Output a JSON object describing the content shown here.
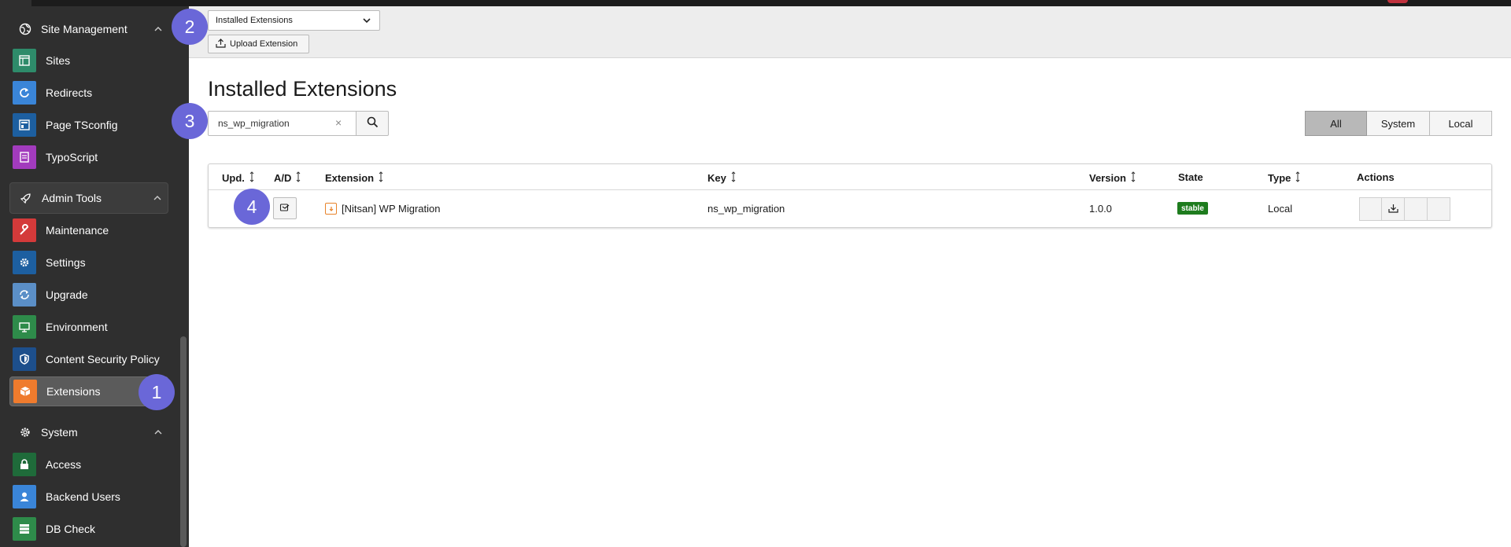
{
  "sidebar": {
    "groups": {
      "site_management": {
        "label": "Site Management",
        "icon": "globe-icon"
      },
      "admin_tools": {
        "label": "Admin Tools",
        "icon": "rocket-icon"
      },
      "system": {
        "label": "System",
        "icon": "gear-icon"
      }
    },
    "items": {
      "sites": {
        "label": "Sites",
        "color": "#2e8b6a"
      },
      "redirects": {
        "label": "Redirects",
        "color": "#3a85d8"
      },
      "page_tsconfig": {
        "label": "Page TSconfig",
        "color": "#1d5fa0"
      },
      "typoscript": {
        "label": "TypoScript",
        "color": "#a23bbd"
      },
      "maintenance": {
        "label": "Maintenance",
        "color": "#d43a3a"
      },
      "settings": {
        "label": "Settings",
        "color": "#1d5fa0"
      },
      "upgrade": {
        "label": "Upgrade",
        "color": "#5b8fc7"
      },
      "environment": {
        "label": "Environment",
        "color": "#2e8b4a"
      },
      "csp": {
        "label": "Content Security Policy",
        "color": "#1d4f8c"
      },
      "extensions": {
        "label": "Extensions",
        "color": "#ef7b2d"
      },
      "access": {
        "label": "Access",
        "color": "#1f6b3a"
      },
      "backend_users": {
        "label": "Backend Users",
        "color": "#3a85d8"
      },
      "db_check": {
        "label": "DB Check",
        "color": "#2e8b4a"
      }
    }
  },
  "header": {
    "select_value": "Installed Extensions",
    "upload_label": "Upload Extension"
  },
  "main": {
    "title": "Installed Extensions",
    "search_value": "ns_wp_migration",
    "filters": [
      "All",
      "System",
      "Local"
    ],
    "active_filter": "All"
  },
  "table": {
    "columns": {
      "upd": "Upd.",
      "ad": "A/D",
      "extension": "Extension",
      "key": "Key",
      "version": "Version",
      "state": "State",
      "type": "Type",
      "actions": "Actions"
    },
    "rows": [
      {
        "extension": "[Nitsan] WP Migration",
        "key": "ns_wp_migration",
        "version": "1.0.0",
        "state": "stable",
        "type": "Local"
      }
    ]
  },
  "markers": [
    "1",
    "2",
    "3",
    "4"
  ],
  "colors": {
    "marker": "#6a67d8",
    "stable": "#1e7c1e",
    "sidebar": "#2f2f2f"
  }
}
